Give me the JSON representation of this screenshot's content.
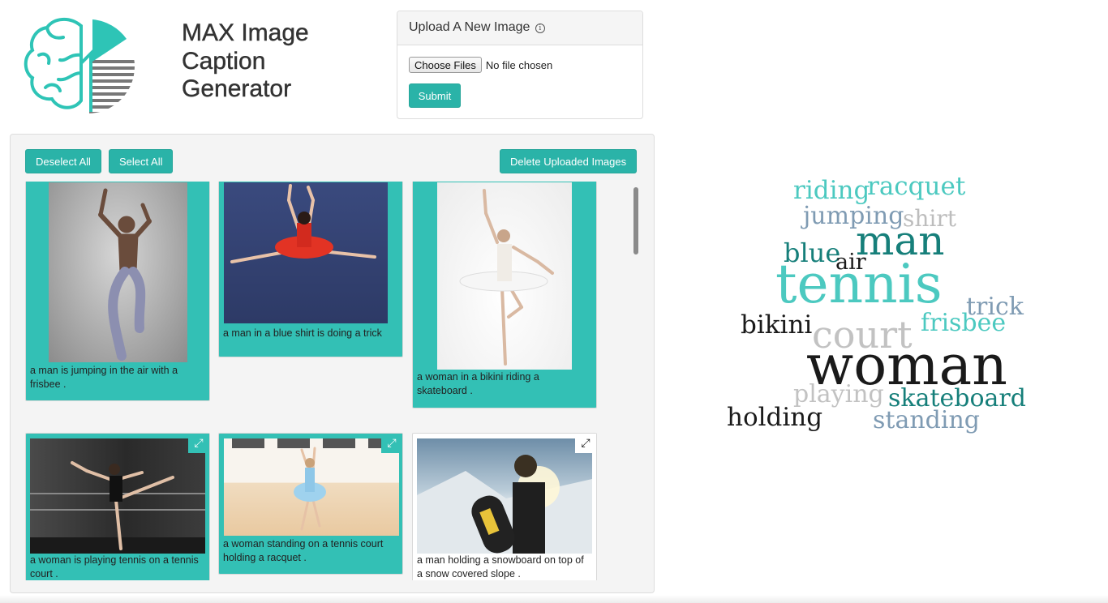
{
  "app": {
    "title_lines": [
      "MAX Image",
      "Caption",
      "Generator"
    ]
  },
  "upload": {
    "heading": "Upload A New Image",
    "info_glyph": "i",
    "choose_label": "Choose Files",
    "file_status": "No file chosen",
    "submit_label": "Submit"
  },
  "toolbar": {
    "deselect_label": "Deselect All",
    "select_label": "Select All",
    "delete_label": "Delete Uploaded Images"
  },
  "cards": [
    {
      "caption": "a man is jumping in the air with a frisbee .",
      "selected": true
    },
    {
      "caption": "a man in a blue shirt is doing a trick",
      "selected": true
    },
    {
      "caption": "a woman in a bikini riding a skateboard .",
      "selected": true
    },
    {
      "caption": "a woman is playing tennis on a tennis court .",
      "selected": true
    },
    {
      "caption": "a woman standing on a tennis court holding a racquet .",
      "selected": true
    },
    {
      "caption": "a man holding a snowboard on top of a snow covered slope .",
      "selected": false
    }
  ],
  "icons": {
    "expand": "expand-icon",
    "logo": "brain-logo-icon"
  },
  "colors": {
    "accent": "#2ab3a8",
    "card_selected": "#33c0b5"
  },
  "wordcloud": [
    {
      "text": "riding",
      "color": "#4cc9c0"
    },
    {
      "text": "racquet",
      "color": "#4cc9c0"
    },
    {
      "text": "jumping",
      "color": "#7f9bb3"
    },
    {
      "text": "shirt",
      "color": "#bdbdbd"
    },
    {
      "text": "man",
      "color": "#167f7a"
    },
    {
      "text": "blue",
      "color": "#167f7a"
    },
    {
      "text": "air",
      "color": "#1a1a1a"
    },
    {
      "text": "tennis",
      "color": "#4cc9c0"
    },
    {
      "text": "trick",
      "color": "#7f9bb3"
    },
    {
      "text": "bikini",
      "color": "#1a1a1a"
    },
    {
      "text": "court",
      "color": "#c2c2c2"
    },
    {
      "text": "frisbee",
      "color": "#4cc9c0"
    },
    {
      "text": "woman",
      "color": "#1a1a1a"
    },
    {
      "text": "playing",
      "color": "#c2c2c2"
    },
    {
      "text": "skateboard",
      "color": "#167f7a"
    },
    {
      "text": "holding",
      "color": "#1a1a1a"
    },
    {
      "text": "standing",
      "color": "#7f9bb3"
    }
  ]
}
